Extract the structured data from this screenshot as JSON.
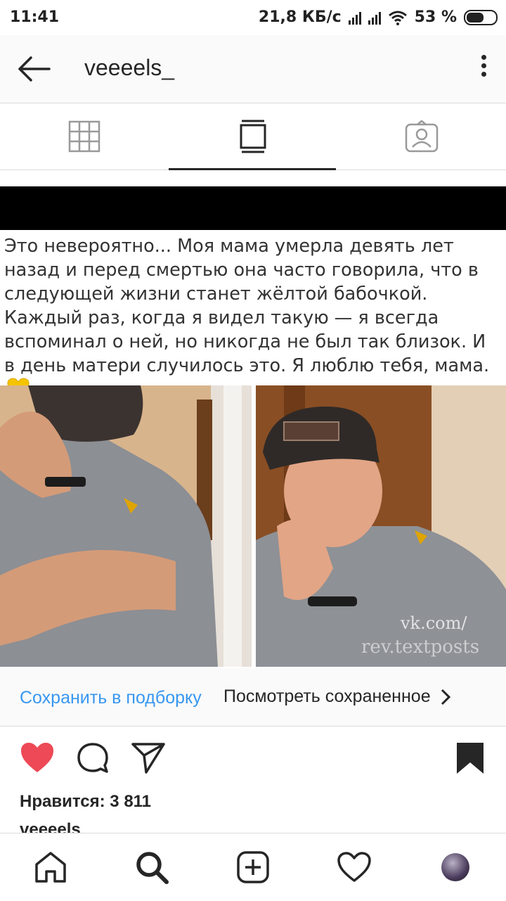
{
  "status_bar": {
    "time": "11:41",
    "network_speed": "21,8 КБ/с",
    "battery": "53 %"
  },
  "header": {
    "username": "veeeels_"
  },
  "tabs": [
    {
      "name": "grid",
      "icon": "grid-icon"
    },
    {
      "name": "feed",
      "icon": "post-icon"
    },
    {
      "name": "tagged",
      "icon": "tagged-person-icon"
    }
  ],
  "post": {
    "text": "Это невероятно... Моя мама умерла девять лет назад и перед смертью она часто говорила, что в следующей жизни станет жёлтой бабочкой. Каждый раз, когда я видел такую — я всегда вспоминал о ней, но никогда не был так близок. И в день матери случилось это. Я люблю тебя, мама.",
    "emoji": "yellow-heart",
    "watermark": "vk.com/\nrev.textposts"
  },
  "save_bar": {
    "save_link": "Сохранить в подборку",
    "view_saved": "Посмотреть сохраненное"
  },
  "engagement": {
    "likes": "Нравится: 3 811",
    "caption_user": "veeeels_"
  },
  "colors": {
    "link_blue": "#3897f0",
    "like_red": "#ed4956",
    "text_dark": "#262626"
  }
}
